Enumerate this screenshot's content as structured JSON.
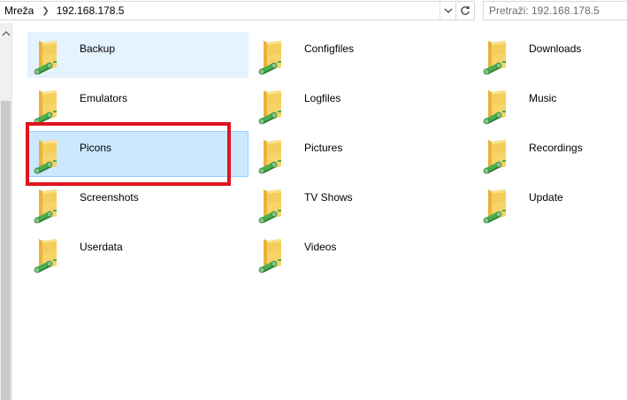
{
  "address_bar": {
    "crumbs": [
      "Mreža",
      "192.168.178.5"
    ],
    "separator": ">"
  },
  "search": {
    "placeholder": "Pretraži: 192.168.178.5"
  },
  "folders": [
    {
      "label": "Backup",
      "state": "hover"
    },
    {
      "label": "Configfiles",
      "state": "normal"
    },
    {
      "label": "Downloads",
      "state": "normal"
    },
    {
      "label": "Emulators",
      "state": "normal"
    },
    {
      "label": "Logfiles",
      "state": "normal"
    },
    {
      "label": "Music",
      "state": "normal"
    },
    {
      "label": "Picons",
      "state": "selected"
    },
    {
      "label": "Pictures",
      "state": "normal"
    },
    {
      "label": "Recordings",
      "state": "normal"
    },
    {
      "label": "Screenshots",
      "state": "normal"
    },
    {
      "label": "TV Shows",
      "state": "normal"
    },
    {
      "label": "Update",
      "state": "normal"
    },
    {
      "label": "Userdata",
      "state": "normal"
    },
    {
      "label": "Videos",
      "state": "normal"
    }
  ],
  "colors": {
    "selection_bg": "#cce8ff",
    "selection_border": "#99d1ff",
    "hover_bg": "#e5f3ff",
    "highlight": "#e0141e",
    "folder_yellow": "#f5cd5a",
    "share_green": "#4caf50"
  }
}
